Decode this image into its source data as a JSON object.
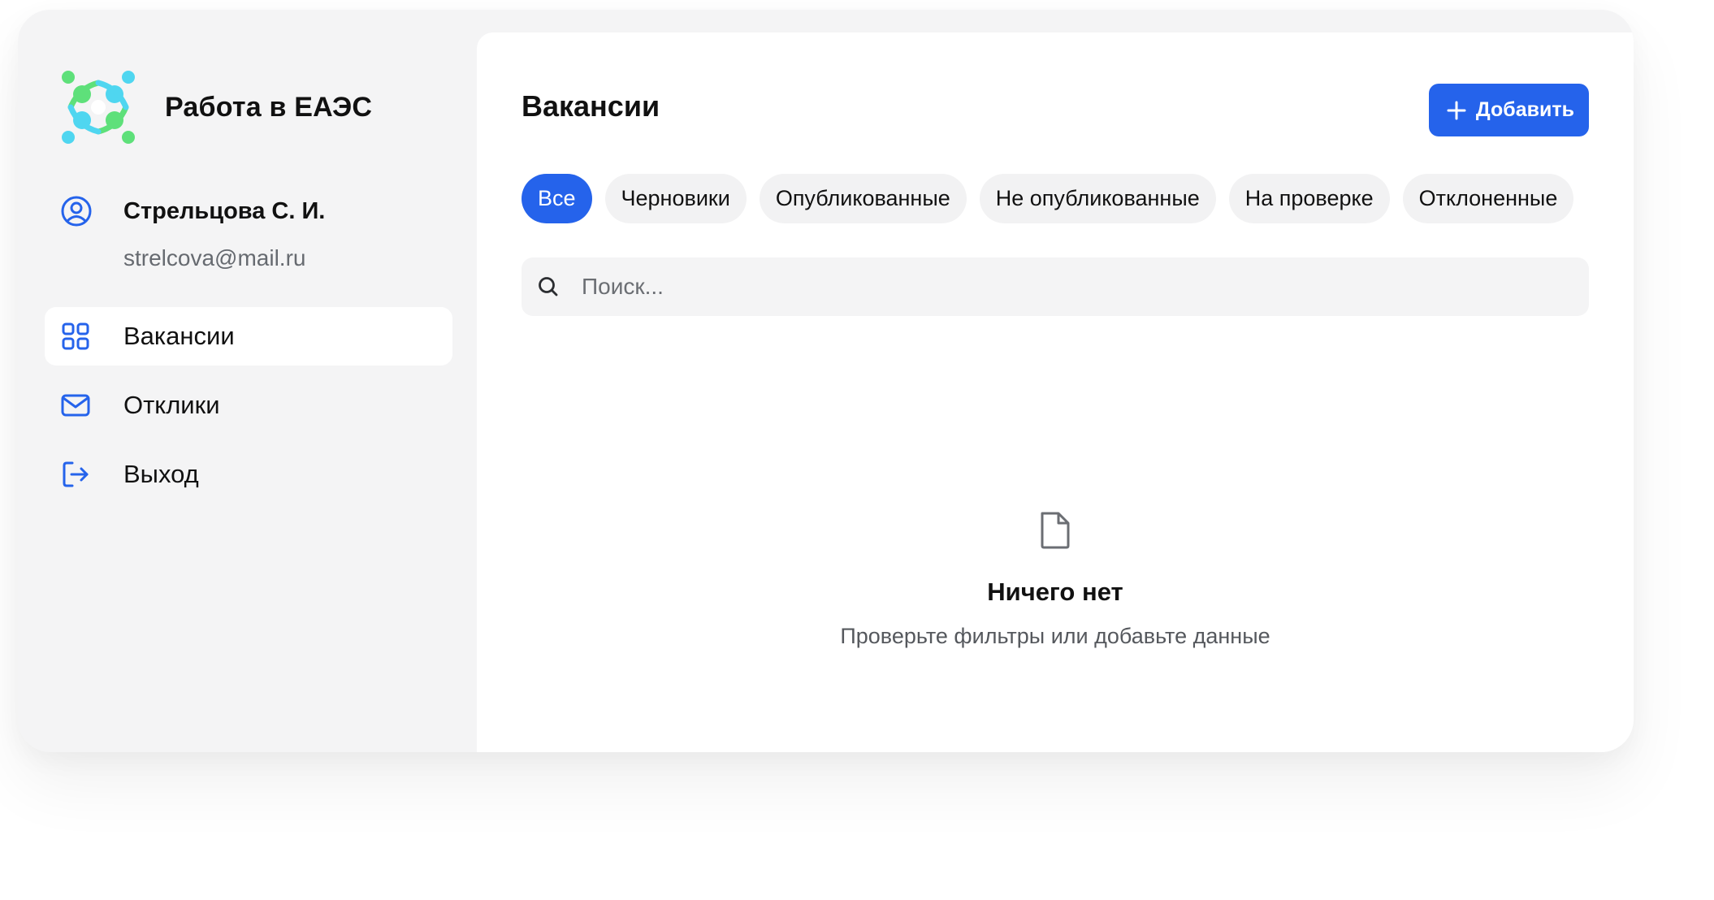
{
  "brand": {
    "name": "Работа в ЕАЭС",
    "logo_icon": "eaeu-people-logo"
  },
  "user": {
    "name": "Стрельцова С. И.",
    "email": "strelcova@mail.ru",
    "icon": "user-circle-icon"
  },
  "sidebar": {
    "items": [
      {
        "label": "Вакансии",
        "icon": "grid-icon",
        "active": true
      },
      {
        "label": "Отклики",
        "icon": "mail-icon",
        "active": false
      },
      {
        "label": "Выход",
        "icon": "logout-icon",
        "active": false
      }
    ]
  },
  "main": {
    "title": "Вакансии",
    "add_button_label": "Добавить",
    "filters": [
      {
        "label": "Все",
        "active": true
      },
      {
        "label": "Черновики",
        "active": false
      },
      {
        "label": "Опубликованные",
        "active": false
      },
      {
        "label": "Не опубликованные",
        "active": false
      },
      {
        "label": "На проверке",
        "active": false
      },
      {
        "label": "Отклоненные",
        "active": false
      }
    ],
    "search": {
      "placeholder": "Поиск...",
      "value": ""
    },
    "empty_state": {
      "title": "Ничего нет",
      "subtitle": "Проверьте фильтры или добавьте данные",
      "icon": "document-icon"
    }
  },
  "colors": {
    "accent": "#2563eb",
    "sidebar_bg": "#f4f4f5",
    "logo_green": "#5ee07a",
    "logo_cyan": "#4fd6f0"
  }
}
